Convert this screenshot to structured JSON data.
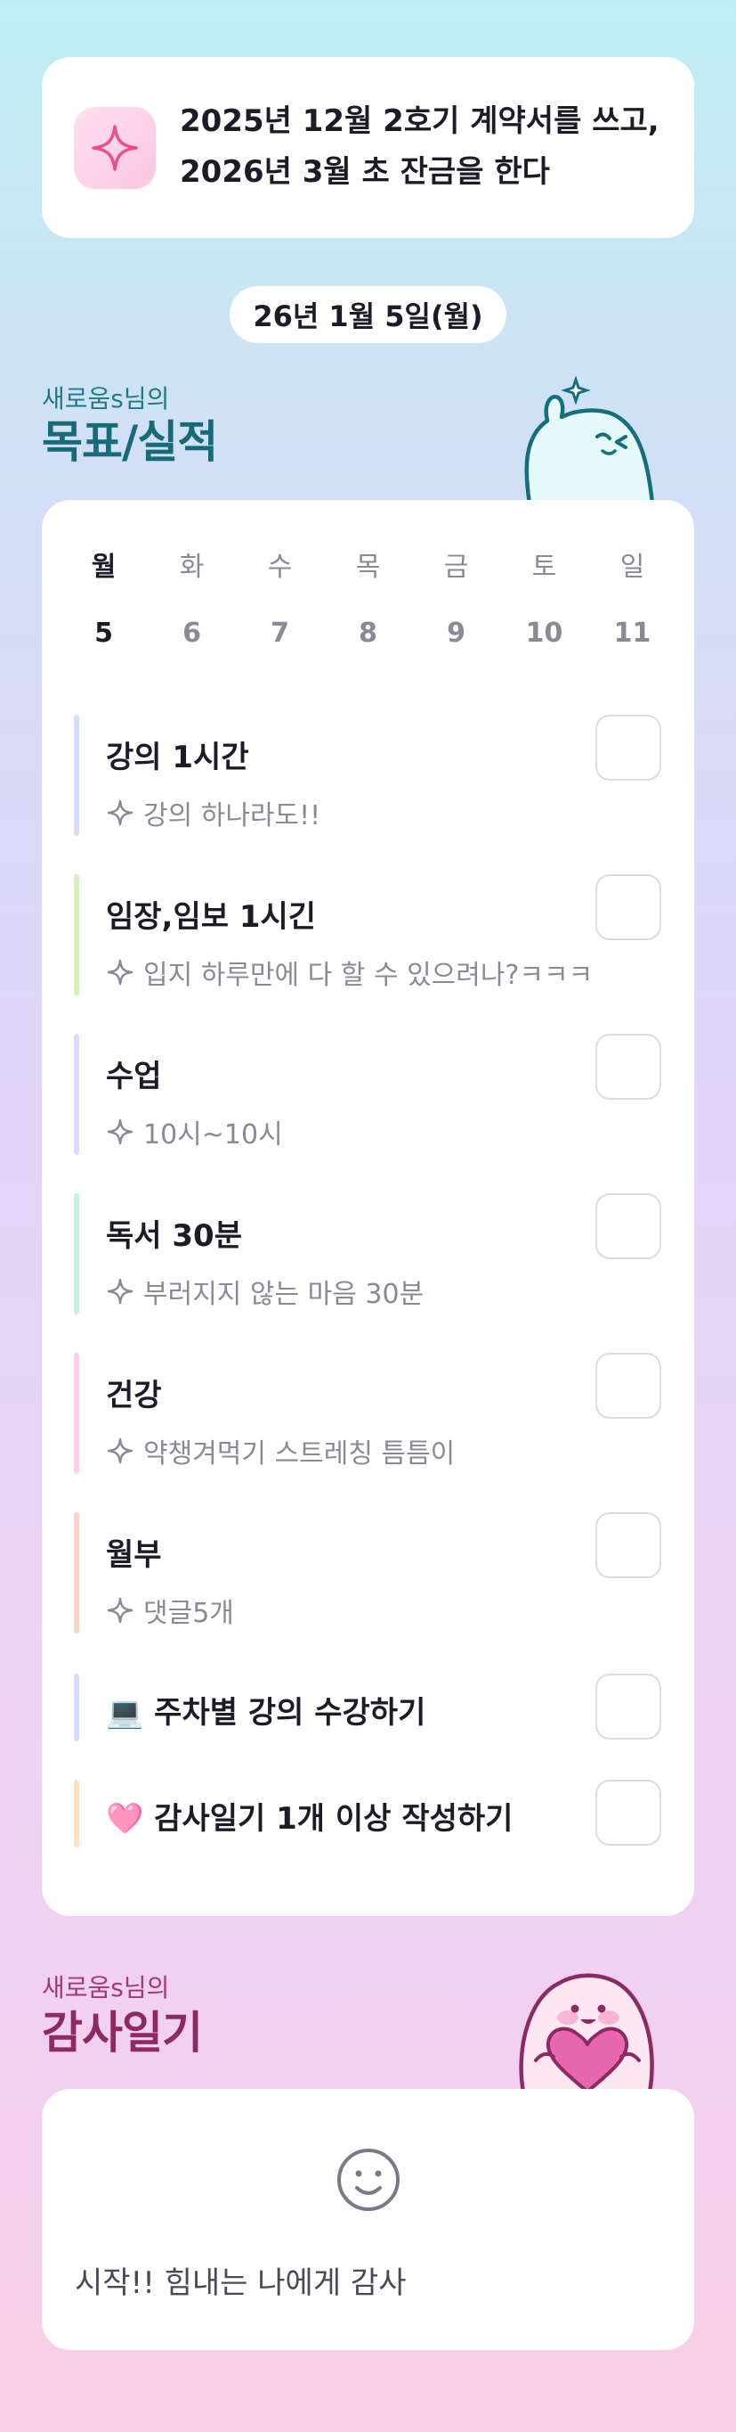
{
  "goal": {
    "line1": "2025년 12월 2호기 계약서를 쓰고,",
    "line2": "2026년 3월 초 잔금을 한다",
    "icon": "sparkle-icon"
  },
  "date": "26년 1월 5일(월)",
  "goals_section": {
    "subtitle": "새로움s님의",
    "title": "목표/실적"
  },
  "week": {
    "days": [
      "월",
      "화",
      "수",
      "목",
      "금",
      "토",
      "일"
    ],
    "dates": [
      "5",
      "6",
      "7",
      "8",
      "9",
      "10",
      "11"
    ],
    "active_index": 0
  },
  "tasks": [
    {
      "title": "강의 1시간",
      "note": "강의 하나라도!!",
      "color": "#d6dcfb",
      "checked": false
    },
    {
      "title": "임장,임보 1시긴",
      "note": "입지 하루만에 다 할 수 있으려나?ㅋㅋㅋ",
      "color": "#d9f1b8",
      "checked": false
    },
    {
      "title": "수업",
      "note": "10시~10시",
      "color": "#e2d8fb",
      "checked": false
    },
    {
      "title": "독서 30분",
      "note": "부러지지 않는 마음 30분",
      "color": "#c6f0dd",
      "checked": false
    },
    {
      "title": "건강",
      "note": "약챙겨먹기 스트레칭 틈틈이",
      "color": "#fbd0e7",
      "checked": false
    },
    {
      "title": "월부",
      "note": "댓글5개",
      "color": "#fcd3cc",
      "checked": false
    },
    {
      "title": "💻 주차별 강의 수강하기",
      "note": "",
      "color": "#d6dcfb",
      "checked": false
    },
    {
      "title": "🩷 감사일기 1개 이상 작성하기",
      "note": "",
      "color": "#fde2c2",
      "checked": false
    }
  ],
  "thanks_section": {
    "subtitle": "새로움s님의",
    "title": "감사일기",
    "icon": "smile-icon",
    "text": "시작!! 힘내는 나에게 감사"
  }
}
